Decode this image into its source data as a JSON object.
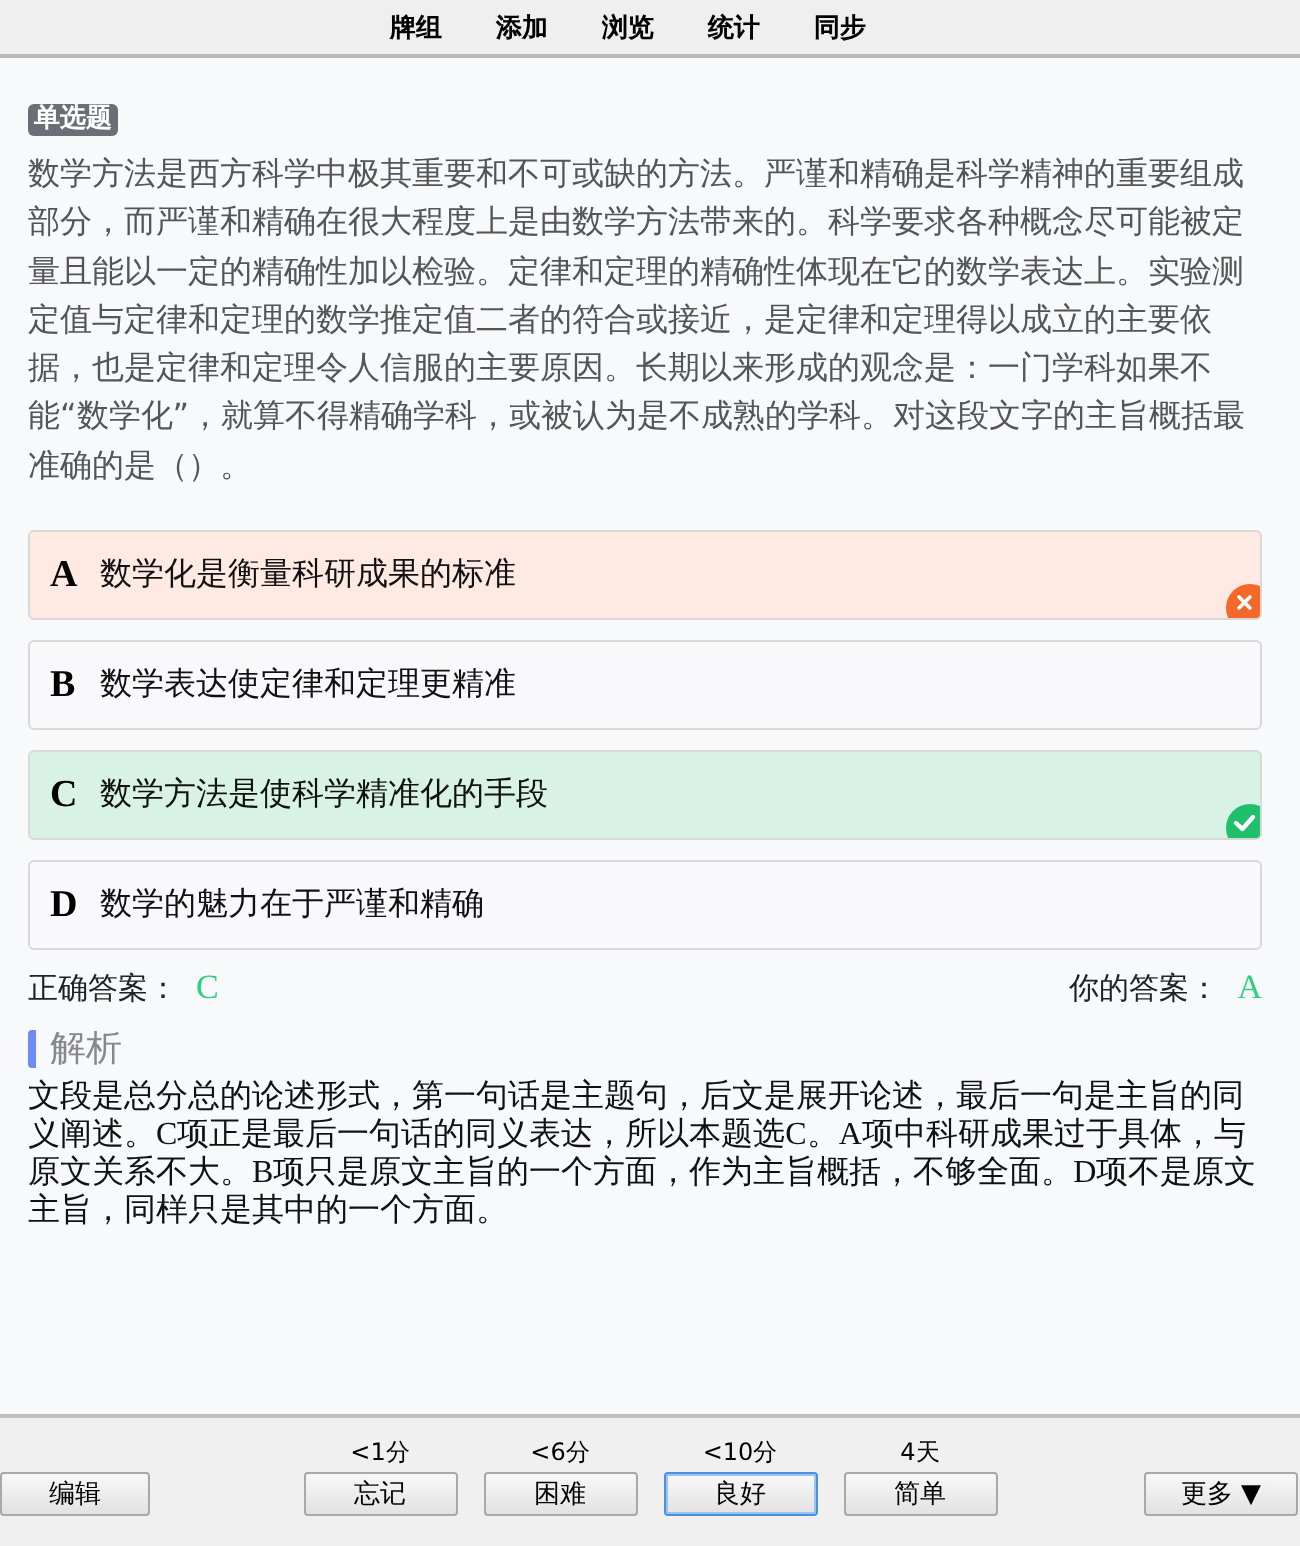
{
  "top_nav": [
    {
      "label": "牌组"
    },
    {
      "label": "添加"
    },
    {
      "label": "浏览"
    },
    {
      "label": "统计"
    },
    {
      "label": "同步"
    }
  ],
  "question": {
    "type_tag": "单选题",
    "text": "数学方法是西方科学中极其重要和不可或缺的方法。严谨和精确是科学精神的重要组成部分，而严谨和精确在很大程度上是由数学方法带来的。科学要求各种概念尽可能被定量且能以一定的精确性加以检验。定律和定理的精确性体现在它的数学表达上。实验测定值与定律和定理的数学推定值二者的符合或接近，是定律和定理得以成立的主要依据，也是定律和定理令人信服的主要原因。长期以来形成的观念是：一门学科如果不能“数学化”，就算不得精确学科，或被认为是不成熟的学科。对这段文字的主旨概括最准确的是（）。"
  },
  "options": [
    {
      "letter": "A",
      "text": "数学化是衡量科研成果的标准",
      "kind": "wrong"
    },
    {
      "letter": "B",
      "text": "数学表达使定律和定理更精准",
      "kind": "plain"
    },
    {
      "letter": "C",
      "text": "数学方法是使科学精准化的手段",
      "kind": "correct"
    },
    {
      "letter": "D",
      "text": "数学的魅力在于严谨和精确",
      "kind": "plain"
    }
  ],
  "answer": {
    "correct_label": "正确答案：",
    "correct_value": "C",
    "yours_label": "你的答案：",
    "yours_value": "A"
  },
  "explanation": {
    "heading": "解析",
    "text": "文段是总分总的论述形式，第一句话是主题句，后文是展开论述，最后一句是主旨的同义阐述。C项正是最后一句话的同义表达，所以本题选C。A项中科研成果过于具体，与原文关系不大。B项只是原文主旨的一个方面，作为主旨概括，不够全面。D项不是原文主旨，同样只是其中的一个方面。"
  },
  "bottom_bar": {
    "edit_button": "编辑",
    "ease_buttons": [
      {
        "interval": "<1分",
        "label": "忘记",
        "focused": false
      },
      {
        "interval": "<6分",
        "label": "困难",
        "focused": false
      },
      {
        "interval": "<10分",
        "label": "良好",
        "focused": true
      },
      {
        "interval": "4天",
        "label": "简单",
        "focused": false
      }
    ],
    "more_button": "更多 ▼"
  }
}
